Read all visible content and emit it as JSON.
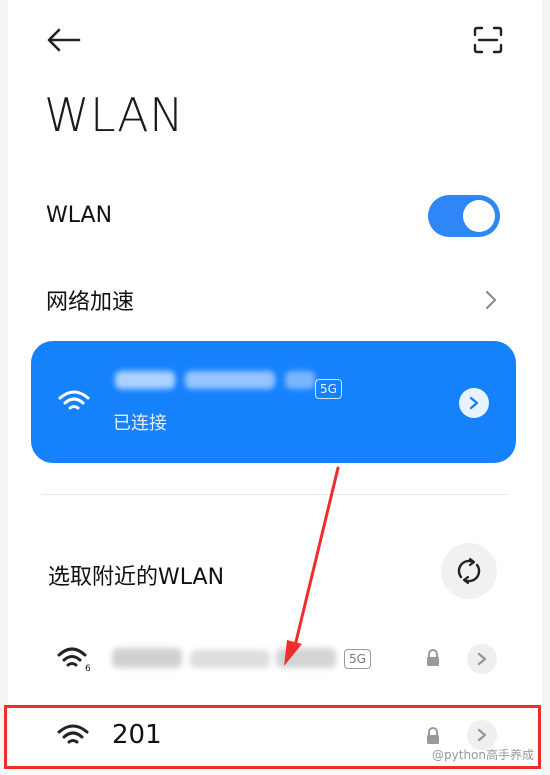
{
  "page": {
    "title": "WLAN"
  },
  "toolbar": {
    "back_icon": "back-arrow-icon",
    "scan_icon": "scan-icon"
  },
  "wlan_toggle": {
    "label": "WLAN",
    "on": true,
    "accent": "#2f86f6"
  },
  "network_acceleration": {
    "label": "网络加速"
  },
  "connected_network": {
    "ssid": "",
    "band": "5G",
    "status": "已连接",
    "card_color": "#1581fb"
  },
  "nearby": {
    "header": "选取附近的WLAN",
    "networks": [
      {
        "ssid": "",
        "band": "5G",
        "wifi_badge": "6",
        "secured": true
      },
      {
        "ssid": "201",
        "band": "",
        "secured": true
      }
    ]
  },
  "annotation": {
    "color": "#ee2d2d"
  },
  "watermark": {
    "text": "@python高手养成"
  }
}
